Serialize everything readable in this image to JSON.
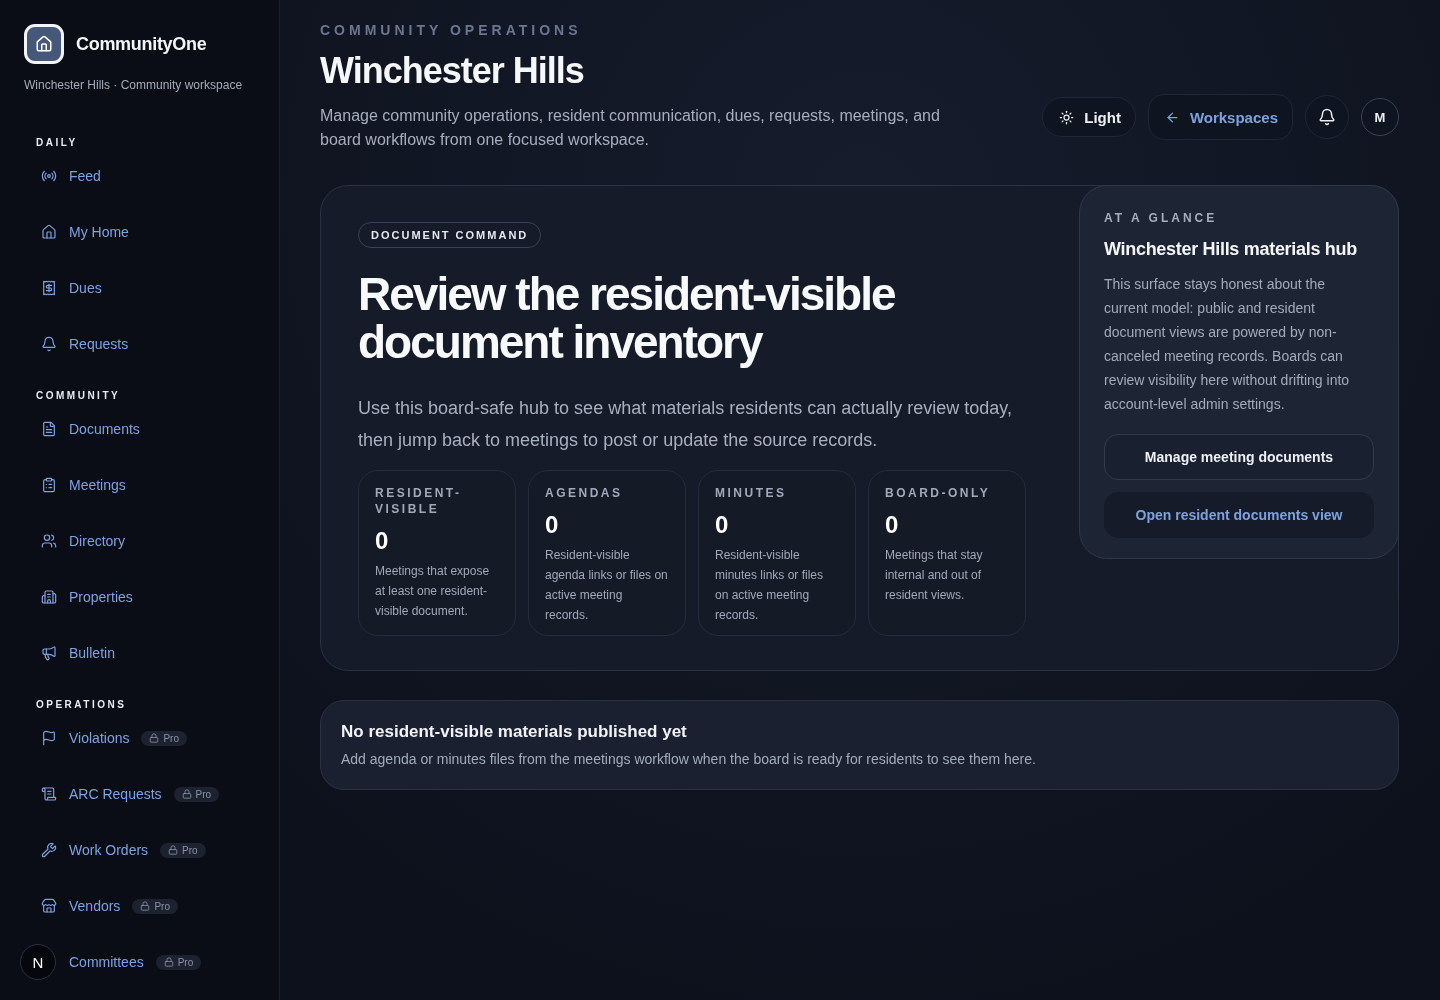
{
  "brand": {
    "name": "CommunityOne",
    "subtitle": "Winchester Hills · Community workspace"
  },
  "sidebar": {
    "sections": [
      {
        "heading": "DAILY",
        "items": [
          {
            "label": "Feed"
          },
          {
            "label": "My Home"
          },
          {
            "label": "Dues"
          },
          {
            "label": "Requests"
          }
        ]
      },
      {
        "heading": "COMMUNITY",
        "items": [
          {
            "label": "Documents"
          },
          {
            "label": "Meetings"
          },
          {
            "label": "Directory"
          },
          {
            "label": "Properties"
          },
          {
            "label": "Bulletin"
          }
        ]
      },
      {
        "heading": "OPERATIONS",
        "items": [
          {
            "label": "Violations",
            "badge": "Pro"
          },
          {
            "label": "ARC Requests",
            "badge": "Pro"
          },
          {
            "label": "Work Orders",
            "badge": "Pro"
          },
          {
            "label": "Vendors",
            "badge": "Pro"
          },
          {
            "label": "Committees",
            "badge": "Pro"
          }
        ]
      }
    ]
  },
  "dev_button": "N",
  "header": {
    "eyebrow": "COMMUNITY OPERATIONS",
    "title": "Winchester Hills",
    "description": "Manage community operations, resident communication, dues, requests, meetings, and board workflows from one focused workspace.",
    "theme_button": "Light",
    "workspaces_button": "Workspaces",
    "avatar": "M"
  },
  "hero": {
    "tag": "DOCUMENT COMMAND",
    "title": "Review the resident-visible document inventory",
    "description": "Use this board-safe hub to see what materials residents can actually review today, then jump back to meetings to post or update the source records.",
    "stats": [
      {
        "label": "RESIDENT-VISIBLE",
        "value": "0",
        "note": "Meetings that expose at least one resident-visible document."
      },
      {
        "label": "AGENDAS",
        "value": "0",
        "note": "Resident-visible agenda links or files on active meeting records."
      },
      {
        "label": "MINUTES",
        "value": "0",
        "note": "Resident-visible minutes links or files on active meeting records."
      },
      {
        "label": "BOARD-ONLY",
        "value": "0",
        "note": "Meetings that stay internal and out of resident views."
      }
    ]
  },
  "glance": {
    "eyebrow": "AT A GLANCE",
    "title": "Winchester Hills materials hub",
    "text": "This surface stays honest about the current model: public and resident document views are powered by non-canceled meeting records. Boards can review visibility here without drifting into account-level admin settings.",
    "primary_button": "Manage meeting documents",
    "secondary_button": "Open resident documents view"
  },
  "empty_state": {
    "title": "No resident-visible materials published yet",
    "text": "Add agenda or minutes files from the meetings workflow when the board is ready for residents to see them here."
  }
}
